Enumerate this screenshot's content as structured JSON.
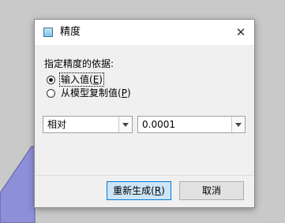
{
  "dialog": {
    "title": "精度",
    "close_symbol": "✕"
  },
  "group": {
    "label": "指定精度的依据:",
    "options": [
      {
        "label_pre": "输入值(",
        "mnemonic": "E",
        "label_post": ")",
        "checked": true
      },
      {
        "label_pre": "从模型复制值(",
        "mnemonic": "P",
        "label_post": ")",
        "checked": false
      }
    ]
  },
  "combos": {
    "mode_value": "相对",
    "precision_value": "0.0001"
  },
  "buttons": {
    "regenerate_pre": "重新生成(",
    "regenerate_mnemonic": "R",
    "regenerate_post": ")",
    "cancel": "取消"
  },
  "colors": {
    "backdrop": "#c9c9c9",
    "shape_fill": "#8e8fd9",
    "primary_button_fill": "#cce4f7",
    "primary_button_border": "#0078d7"
  }
}
